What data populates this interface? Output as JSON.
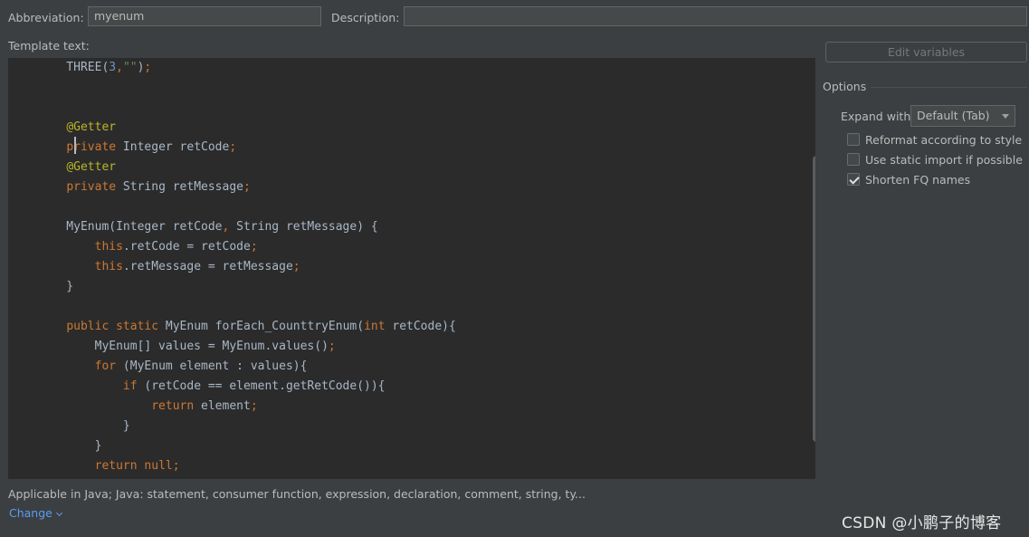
{
  "header": {
    "abbreviation_label": "Abbreviation:",
    "abbreviation_value": "myenum",
    "description_label": "Description:",
    "description_value": ""
  },
  "template": {
    "label": "Template text:",
    "lines": [
      "    THREE(3,\"\");",
      "",
      "",
      "    @Getter",
      "    private Integer retCode;",
      "    @Getter",
      "    private String retMessage;",
      "",
      "    MyEnum(Integer retCode, String retMessage) {",
      "        this.retCode = retCode;",
      "        this.retMessage = retMessage;",
      "    }",
      "",
      "    public static MyEnum forEach_CounttryEnum(int retCode){",
      "        MyEnum[] values = MyEnum.values();",
      "        for (MyEnum element : values){",
      "            if (retCode == element.getRetCode()){",
      "                return element;",
      "            }",
      "        }",
      "        return null;"
    ]
  },
  "right_panel": {
    "edit_variables_label": "Edit variables",
    "options_title": "Options",
    "expand_with_label": "Expand with",
    "expand_with_value": "Default (Tab)",
    "checkboxes": [
      {
        "label": "Reformat according to style",
        "checked": false
      },
      {
        "label": "Use static import if possible",
        "checked": false
      },
      {
        "label": "Shorten FQ names",
        "checked": true
      }
    ]
  },
  "footer": {
    "applicable_text": "Applicable in Java; Java: statement, consumer function, expression, declaration, comment, string, ty...",
    "change_label": "Change"
  },
  "watermark": "CSDN @小鹏子的博客",
  "colors": {
    "background": "#3c3f41",
    "editor_background": "#2b2b2b",
    "keyword": "#cc7832",
    "link": "#589df6"
  }
}
